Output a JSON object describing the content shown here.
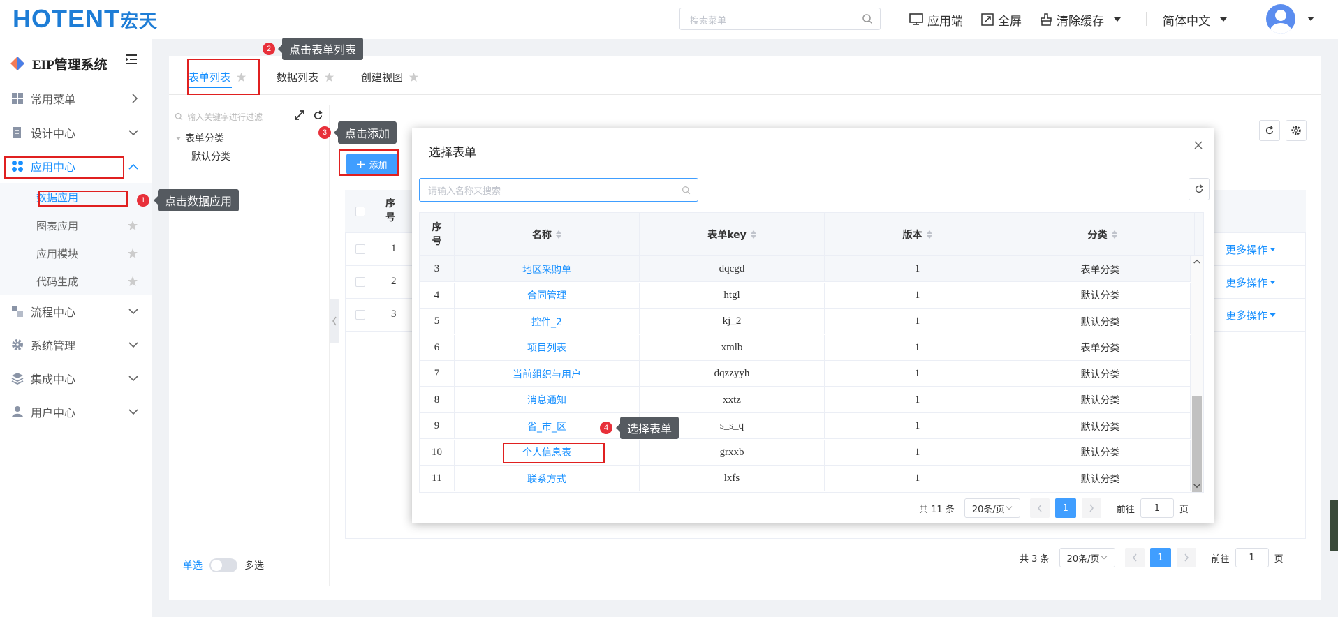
{
  "topbar": {
    "logo_text": "HOTENT",
    "logo_cn": "宏天",
    "search_placeholder": "搜索菜单",
    "app_label": "应用端",
    "fullscreen_label": "全屏",
    "clear_cache_label": "清除缓存",
    "language_label": "简体中文"
  },
  "sidebar": {
    "title": "EIP管理系统",
    "items": [
      {
        "label": "常用菜单",
        "icon": "grid-icon"
      },
      {
        "label": "设计中心",
        "icon": "design-doc-icon"
      },
      {
        "label": "应用中心",
        "icon": "apps-icon"
      },
      {
        "label": "流程中心",
        "icon": "flow-icon"
      },
      {
        "label": "系统管理",
        "icon": "gear-icon"
      },
      {
        "label": "集成中心",
        "icon": "layers-icon"
      },
      {
        "label": "用户中心",
        "icon": "user-icon"
      }
    ],
    "sub_items": [
      {
        "label": "数据应用"
      },
      {
        "label": "图表应用"
      },
      {
        "label": "应用模块"
      },
      {
        "label": "代码生成"
      }
    ]
  },
  "tabs": [
    {
      "label": "表单列表"
    },
    {
      "label": "数据列表"
    },
    {
      "label": "创建视图"
    }
  ],
  "tree": {
    "search_placeholder": "输入关键字进行过滤",
    "root": "表单分类",
    "child": "默认分类",
    "single_label": "单选",
    "multi_label": "多选"
  },
  "list": {
    "add_label": "添加",
    "col_index": "序号",
    "rows": [
      "1",
      "2",
      "3"
    ],
    "more_ops": "更多操作",
    "total": "共 3 条",
    "page_size": "20条/页",
    "current_page": "1",
    "goto_label": "前往",
    "goto_page": "1",
    "page_unit": "页"
  },
  "dialog": {
    "title": "选择表单",
    "search_placeholder": "请输入名称来搜索",
    "headers": {
      "index": "序号",
      "name": "名称",
      "key": "表单key",
      "version": "版本",
      "category": "分类"
    },
    "rows": [
      {
        "index": "3",
        "name": "地区采购单",
        "key": "dqcgd",
        "version": "1",
        "category": "表单分类"
      },
      {
        "index": "4",
        "name": "合同管理",
        "key": "htgl",
        "version": "1",
        "category": "默认分类"
      },
      {
        "index": "5",
        "name": "控件_2",
        "key": "kj_2",
        "version": "1",
        "category": "默认分类"
      },
      {
        "index": "6",
        "name": "项目列表",
        "key": "xmlb",
        "version": "1",
        "category": "表单分类"
      },
      {
        "index": "7",
        "name": "当前组织与用户",
        "key": "dqzzyyh",
        "version": "1",
        "category": "默认分类"
      },
      {
        "index": "8",
        "name": "消息通知",
        "key": "xxtz",
        "version": "1",
        "category": "默认分类"
      },
      {
        "index": "9",
        "name": "省_市_区",
        "key": "s_s_q",
        "version": "1",
        "category": "默认分类"
      },
      {
        "index": "10",
        "name": "个人信息表",
        "key": "grxxb",
        "version": "1",
        "category": "默认分类"
      },
      {
        "index": "11",
        "name": "联系方式",
        "key": "lxfs",
        "version": "1",
        "category": "默认分类"
      }
    ],
    "total": "共 11 条",
    "page_size": "20条/页",
    "current_page": "1",
    "goto_label": "前往",
    "goto_page": "1",
    "page_unit": "页"
  },
  "annotations": [
    {
      "num": "1",
      "text": "点击数据应用"
    },
    {
      "num": "2",
      "text": "点击表单列表"
    },
    {
      "num": "3",
      "text": "点击添加"
    },
    {
      "num": "4",
      "text": "选择表单"
    }
  ],
  "colors": {
    "primary": "#409eff",
    "link": "#1890ff",
    "annotation": "#e02020"
  }
}
